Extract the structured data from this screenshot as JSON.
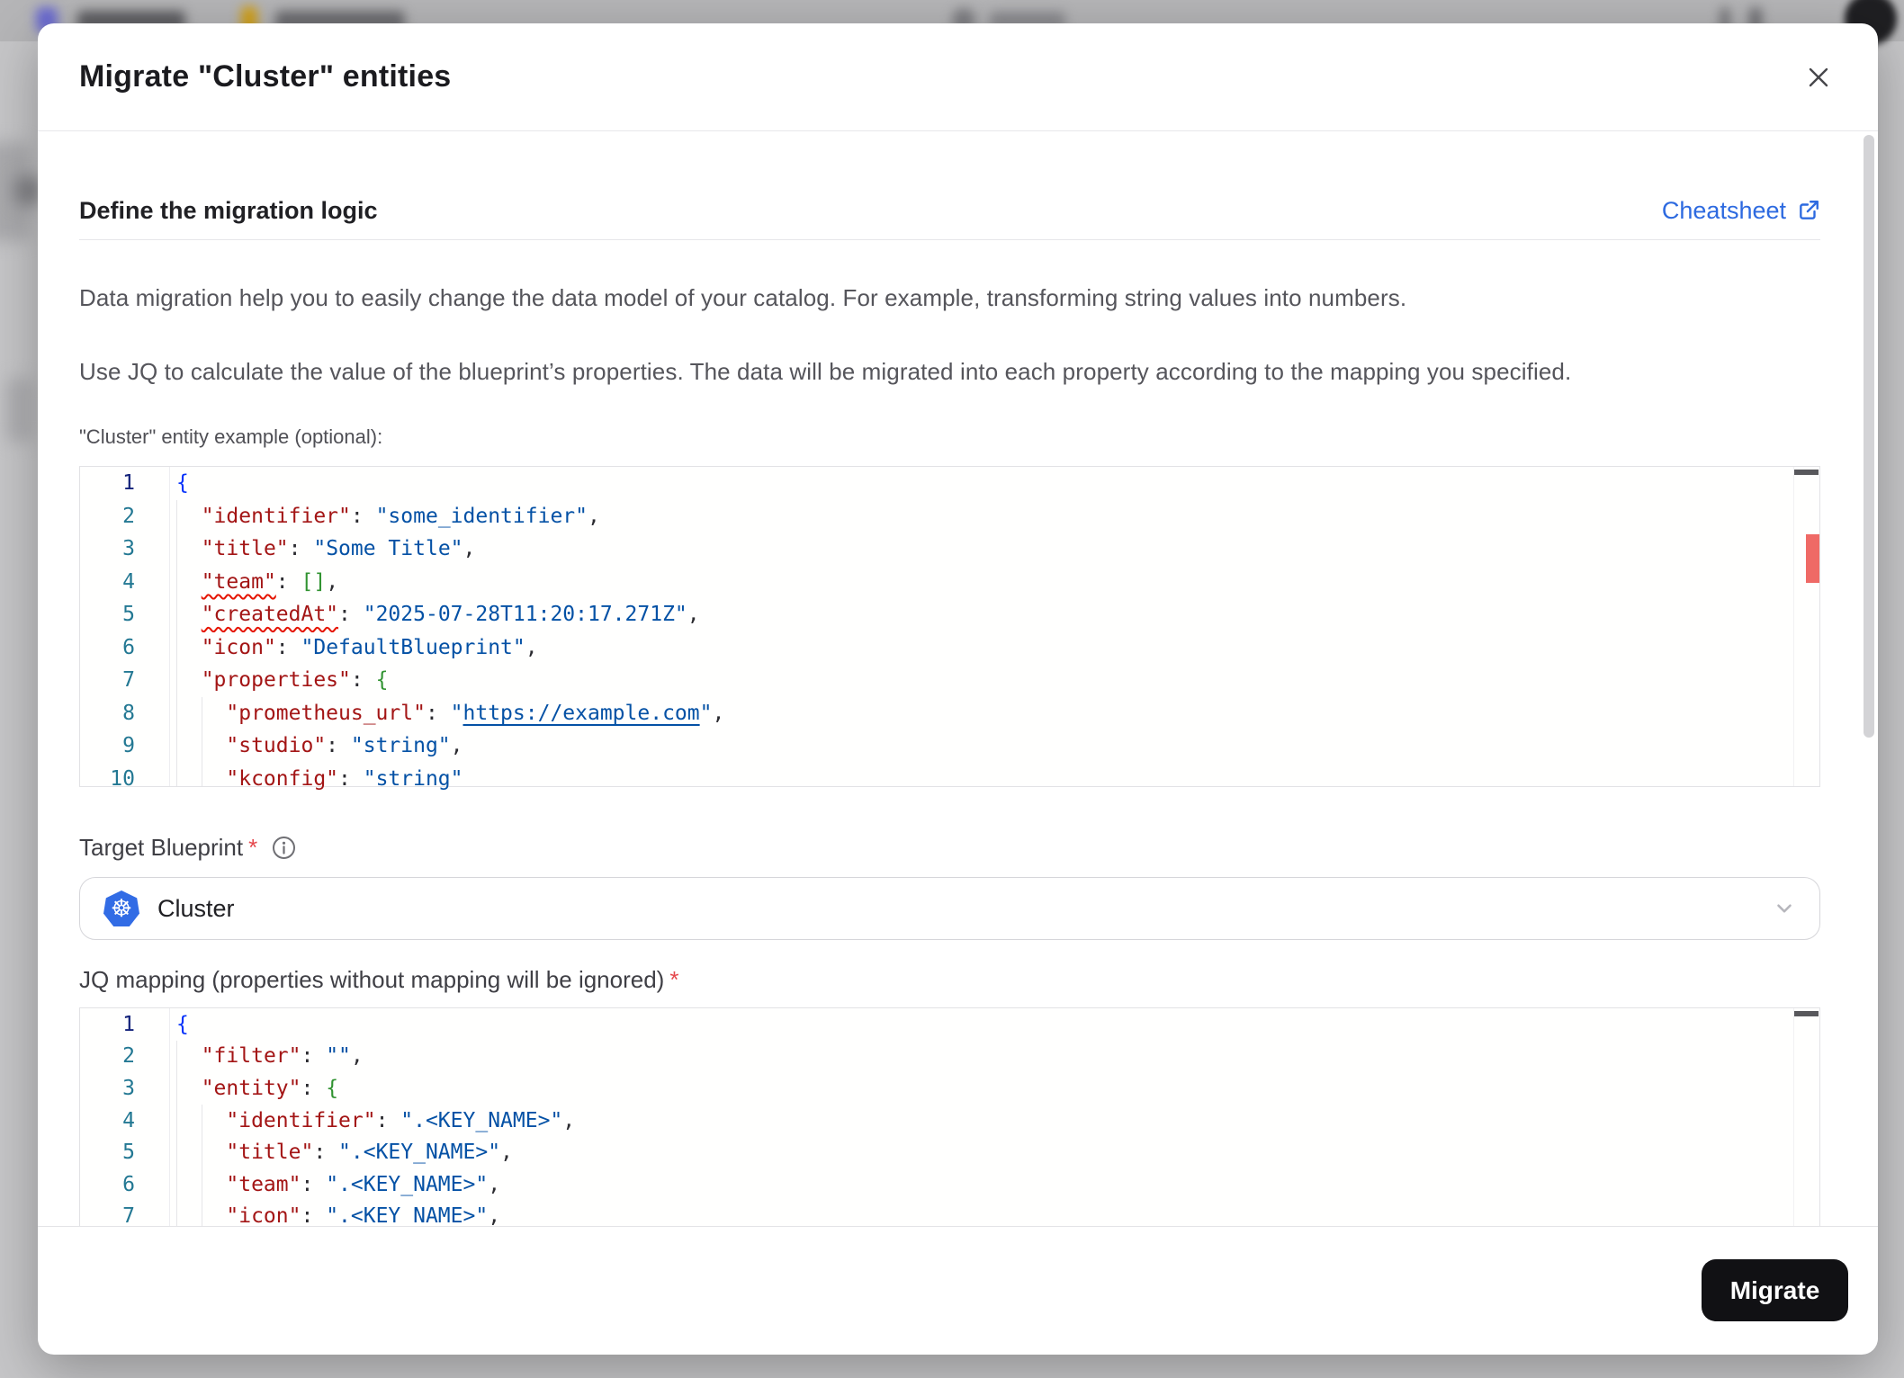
{
  "colors": {
    "accent_blue": "#2D6AE0",
    "kubernetes_blue": "#326CE5",
    "error_red": "#E51400",
    "required_red": "#E5484D",
    "button_bg": "#111114",
    "code_key": "#A31515",
    "code_string": "#0451A5",
    "code_bracket_l1": "#0431FA",
    "code_bracket_l2": "#319331",
    "line_number": "#237893",
    "line_number_active": "#13227A"
  },
  "modal": {
    "title": "Migrate \"Cluster\" entities",
    "section_header": {
      "title": "Define the migration logic",
      "cheatsheet_link": "Cheatsheet"
    },
    "intro": {
      "paragraph_1": "Data migration help you to easily change the data model of your catalog. For example, transforming string values into numbers.",
      "paragraph_2": "Use JQ to calculate the value of the blueprint’s properties. The data will be migrated into each property according to the mapping you specified."
    },
    "entity_example": {
      "label": "\"Cluster\" entity example (optional):",
      "editor": {
        "active_line": 1,
        "lines": [
          {
            "n": 1,
            "tokens": [
              [
                "br1",
                "{"
              ]
            ]
          },
          {
            "n": 2,
            "tokens": [
              [
                "pun",
                "  "
              ],
              [
                "key",
                "\"identifier\""
              ],
              [
                "pun",
                ": "
              ],
              [
                "str",
                "\"some_identifier\""
              ],
              [
                "pun",
                ","
              ]
            ]
          },
          {
            "n": 3,
            "tokens": [
              [
                "pun",
                "  "
              ],
              [
                "key",
                "\"title\""
              ],
              [
                "pun",
                ": "
              ],
              [
                "str",
                "\"Some Title\""
              ],
              [
                "pun",
                ","
              ]
            ]
          },
          {
            "n": 4,
            "tokens": [
              [
                "pun",
                "  "
              ],
              [
                "key",
                "\"team\"",
                "sq"
              ],
              [
                "pun",
                ": "
              ],
              [
                "br2",
                "[]"
              ],
              [
                "pun",
                ","
              ]
            ]
          },
          {
            "n": 5,
            "tokens": [
              [
                "pun",
                "  "
              ],
              [
                "key",
                "\"createdAt\"",
                "sq"
              ],
              [
                "pun",
                ": "
              ],
              [
                "str",
                "\"2025-07-28T11:20:17.271Z\""
              ],
              [
                "pun",
                ","
              ]
            ]
          },
          {
            "n": 6,
            "tokens": [
              [
                "pun",
                "  "
              ],
              [
                "key",
                "\"icon\""
              ],
              [
                "pun",
                ": "
              ],
              [
                "str",
                "\"DefaultBlueprint\""
              ],
              [
                "pun",
                ","
              ]
            ]
          },
          {
            "n": 7,
            "tokens": [
              [
                "pun",
                "  "
              ],
              [
                "key",
                "\"properties\""
              ],
              [
                "pun",
                ": "
              ],
              [
                "br2",
                "{"
              ]
            ]
          },
          {
            "n": 8,
            "tokens": [
              [
                "pun",
                "    "
              ],
              [
                "key",
                "\"prometheus_url\""
              ],
              [
                "pun",
                ": "
              ],
              [
                "str",
                "\""
              ],
              [
                "str",
                "https://example.com",
                "lnk"
              ],
              [
                "str",
                "\""
              ],
              [
                "pun",
                ","
              ]
            ]
          },
          {
            "n": 9,
            "tokens": [
              [
                "pun",
                "    "
              ],
              [
                "key",
                "\"studio\""
              ],
              [
                "pun",
                ": "
              ],
              [
                "str",
                "\"string\""
              ],
              [
                "pun",
                ","
              ]
            ]
          },
          {
            "n": 10,
            "tokens": [
              [
                "pun",
                "    "
              ],
              [
                "key",
                "\"kconfig\""
              ],
              [
                "pun",
                ": "
              ],
              [
                "str",
                "\"string\""
              ]
            ]
          }
        ]
      }
    },
    "target_blueprint": {
      "label": "Target Blueprint",
      "required_mark": "*",
      "selected_value": "Cluster",
      "icon": "kubernetes-icon",
      "kubernetes_glyph": "☸"
    },
    "jq_mapping": {
      "label": "JQ mapping (properties without mapping will be ignored)",
      "required_mark": "*",
      "editor": {
        "active_line": 1,
        "lines": [
          {
            "n": 1,
            "tokens": [
              [
                "br1",
                "{"
              ]
            ]
          },
          {
            "n": 2,
            "tokens": [
              [
                "pun",
                "  "
              ],
              [
                "key",
                "\"filter\""
              ],
              [
                "pun",
                ": "
              ],
              [
                "str",
                "\"\""
              ],
              [
                "pun",
                ","
              ]
            ]
          },
          {
            "n": 3,
            "tokens": [
              [
                "pun",
                "  "
              ],
              [
                "key",
                "\"entity\""
              ],
              [
                "pun",
                ": "
              ],
              [
                "br2",
                "{"
              ]
            ]
          },
          {
            "n": 4,
            "tokens": [
              [
                "pun",
                "    "
              ],
              [
                "key",
                "\"identifier\""
              ],
              [
                "pun",
                ": "
              ],
              [
                "str",
                "\".<KEY_NAME>\""
              ],
              [
                "pun",
                ","
              ]
            ]
          },
          {
            "n": 5,
            "tokens": [
              [
                "pun",
                "    "
              ],
              [
                "key",
                "\"title\""
              ],
              [
                "pun",
                ": "
              ],
              [
                "str",
                "\".<KEY_NAME>\""
              ],
              [
                "pun",
                ","
              ]
            ]
          },
          {
            "n": 6,
            "tokens": [
              [
                "pun",
                "    "
              ],
              [
                "key",
                "\"team\""
              ],
              [
                "pun",
                ": "
              ],
              [
                "str",
                "\".<KEY_NAME>\""
              ],
              [
                "pun",
                ","
              ]
            ]
          },
          {
            "n": 7,
            "tokens": [
              [
                "pun",
                "    "
              ],
              [
                "key",
                "\"icon\""
              ],
              [
                "pun",
                ": "
              ],
              [
                "str",
                "\".<KEY_NAME>\""
              ],
              [
                "pun",
                ","
              ]
            ]
          }
        ]
      }
    },
    "footer": {
      "migrate_button": "Migrate"
    }
  }
}
